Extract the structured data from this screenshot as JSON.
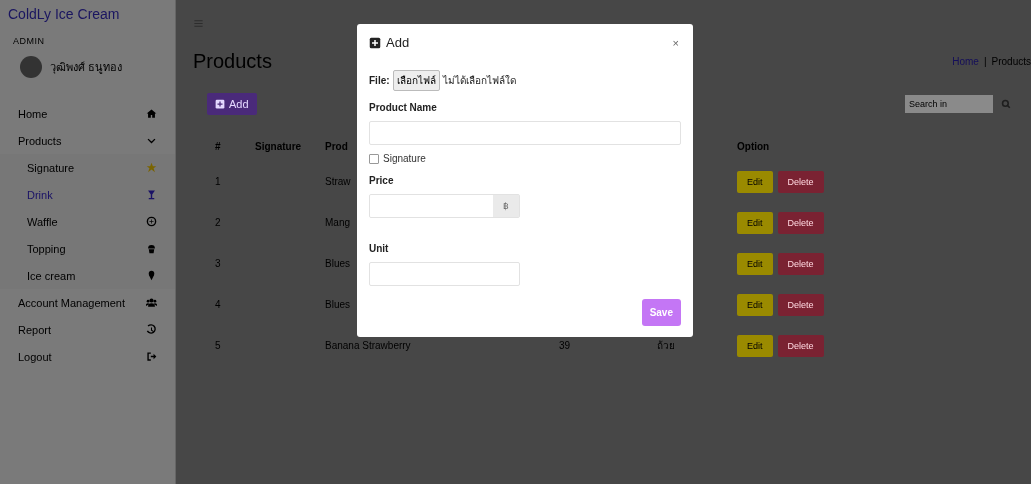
{
  "sidebar": {
    "brand": "ColdLy Ice Cream",
    "role": "ADMIN",
    "user_name": "วุฒิพงศ์ ธนูทอง",
    "items": [
      {
        "label": "Home",
        "selected": false
      },
      {
        "label": "Products",
        "selected": false,
        "expanded": true,
        "children": [
          {
            "label": "Signature",
            "selected": false
          },
          {
            "label": "Drink",
            "selected": true
          },
          {
            "label": "Waffle",
            "selected": false
          },
          {
            "label": "Topping",
            "selected": false
          },
          {
            "label": "Ice cream",
            "selected": false
          }
        ]
      },
      {
        "label": "Account Management",
        "selected": false
      },
      {
        "label": "Report",
        "selected": false
      },
      {
        "label": "Logout",
        "selected": false
      }
    ]
  },
  "main": {
    "title": "Products",
    "breadcrumb": [
      {
        "label": "Home",
        "link": true
      },
      {
        "label": "Products",
        "link": false
      }
    ],
    "breadcrumb_separator": "|",
    "add_button": "Add",
    "search": {
      "placeholder": "Search in"
    },
    "table": {
      "columns": [
        "#",
        "Signature",
        "Prod",
        "Option"
      ],
      "rows": [
        {
          "number": "1",
          "product": "Straw",
          "options": [
            "Edit",
            "Delete"
          ]
        },
        {
          "number": "2",
          "product": "Mang",
          "options": [
            "Edit",
            "Delete"
          ]
        },
        {
          "number": "3",
          "product": "Blues",
          "options": [
            "Edit",
            "Delete"
          ]
        },
        {
          "number": "4",
          "product": "Blues",
          "options": [
            "Edit",
            "Delete"
          ]
        },
        {
          "number": "5",
          "product": "Banana Strawberry",
          "price": "39",
          "unit": "ถ้วย",
          "options": [
            "Edit",
            "Delete"
          ]
        }
      ]
    }
  },
  "modal": {
    "title": "Add",
    "close": "×",
    "file": {
      "label": "File:",
      "button": "เลือกไฟล์",
      "status": "ไม่ได้เลือกไฟล์ใด"
    },
    "fields": [
      {
        "kind": "text",
        "label": "Product Name"
      },
      {
        "kind": "checkbox",
        "label": "Signature",
        "checked": false
      },
      {
        "kind": "addon",
        "label": "Price",
        "addon": "฿"
      },
      {
        "kind": "short",
        "label": "Unit"
      }
    ],
    "save": "Save"
  }
}
